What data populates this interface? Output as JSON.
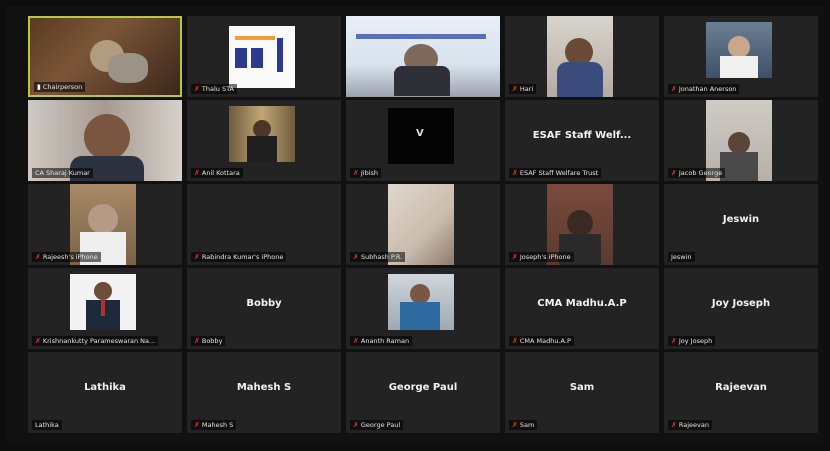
{
  "participants": [
    {
      "label": "Chairperson",
      "muted": false,
      "name_center": "",
      "video": "full-brown"
    },
    {
      "label": "Thalu STA",
      "muted": true,
      "name_center": "",
      "video": "logo"
    },
    {
      "label": "",
      "muted": false,
      "name_center": "",
      "video": "full-slide"
    },
    {
      "label": "Hari",
      "muted": true,
      "name_center": "",
      "video": "center-man-light"
    },
    {
      "label": "Jonathan Anerson",
      "muted": true,
      "name_center": "",
      "video": "center-man-blue"
    },
    {
      "label": "CA Sharaj Kumar",
      "muted": false,
      "name_center": "",
      "video": "full-face"
    },
    {
      "label": "Anil Kottara",
      "muted": true,
      "name_center": "",
      "video": "center-room"
    },
    {
      "label": "Jibish",
      "muted": true,
      "name_center": "",
      "video": "center-dark"
    },
    {
      "label": "ESAF Staff Welfare Trust",
      "muted": true,
      "name_center": "ESAF Staff Welf...",
      "video": "none"
    },
    {
      "label": "Jacob George",
      "muted": true,
      "name_center": "",
      "video": "center-grey"
    },
    {
      "label": "Rajeesh's iPhone",
      "muted": true,
      "name_center": "",
      "video": "center-old"
    },
    {
      "label": "Rabindra Kumar's iPhone",
      "muted": true,
      "name_center": "",
      "video": "none"
    },
    {
      "label": "Subhash P.R.",
      "muted": true,
      "name_center": "",
      "video": "center-wall"
    },
    {
      "label": "Joseph's iPhone",
      "muted": true,
      "name_center": "",
      "video": "center-man-dark"
    },
    {
      "label": "Jeswin",
      "muted": false,
      "name_center": "Jeswin",
      "video": "none"
    },
    {
      "label": "Krishnankutty Parameswaran Na...",
      "muted": true,
      "name_center": "",
      "video": "center-suit"
    },
    {
      "label": "Bobby",
      "muted": true,
      "name_center": "Bobby",
      "video": "none"
    },
    {
      "label": "Ananth Raman",
      "muted": true,
      "name_center": "",
      "video": "center-young"
    },
    {
      "label": "CMA Madhu.A.P",
      "muted": true,
      "name_center": "CMA Madhu.A.P",
      "video": "none"
    },
    {
      "label": "Joy Joseph",
      "muted": true,
      "name_center": "Joy Joseph",
      "video": "none"
    },
    {
      "label": "Lathika",
      "muted": false,
      "name_center": "Lathika",
      "video": "none"
    },
    {
      "label": "Mahesh S",
      "muted": true,
      "name_center": "Mahesh S",
      "video": "none"
    },
    {
      "label": "George Paul",
      "muted": true,
      "name_center": "George Paul",
      "video": "none"
    },
    {
      "label": "Sam",
      "muted": true,
      "name_center": "Sam",
      "video": "none"
    },
    {
      "label": "Rajeevan",
      "muted": true,
      "name_center": "Rajeevan",
      "video": "none"
    }
  ],
  "colors": {
    "active_border": "#b7c93a",
    "muted_icon": "#e4392e",
    "tile_bg": "#232323"
  }
}
